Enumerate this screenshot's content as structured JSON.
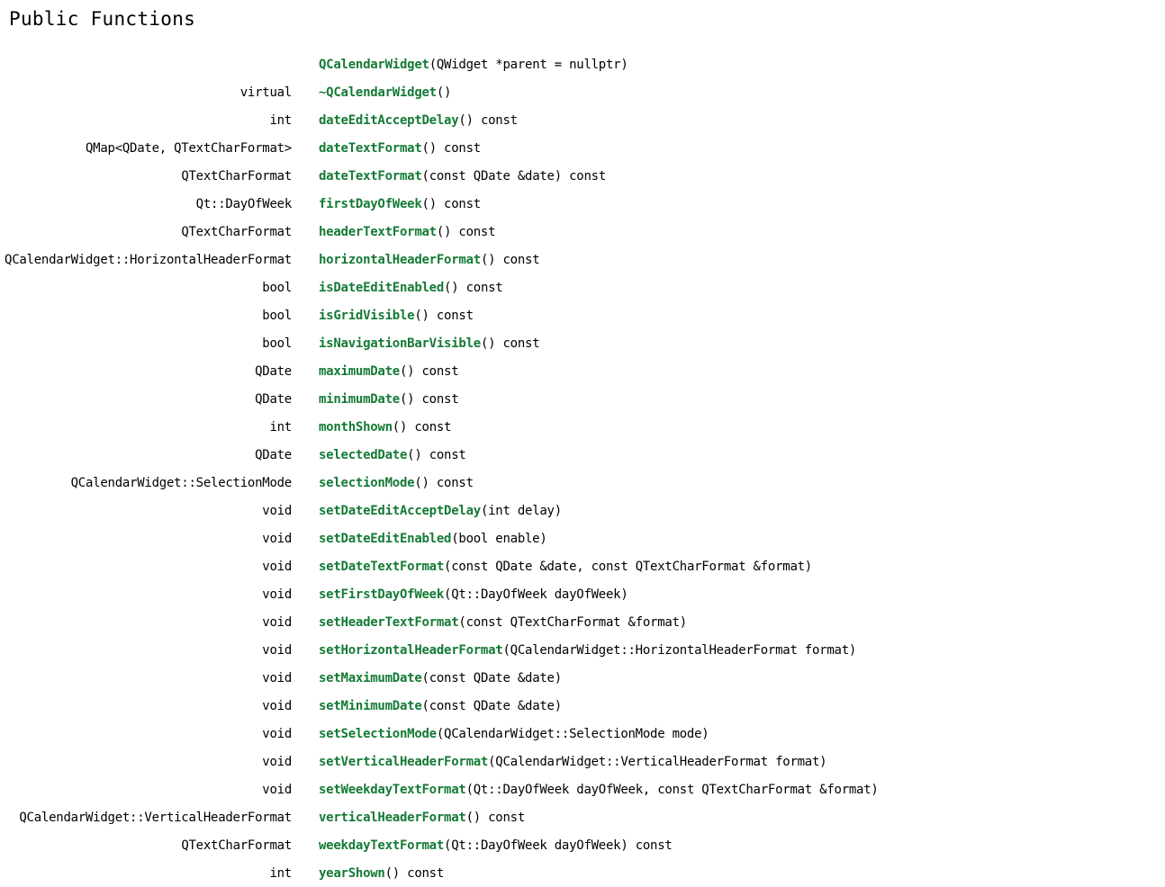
{
  "section_title": "Public Functions",
  "link_color": "#147a35",
  "functions": [
    {
      "ret": "",
      "name": "QCalendarWidget",
      "params": "(QWidget *parent = nullptr)",
      "suffix": ""
    },
    {
      "ret": "virtual",
      "name": "~QCalendarWidget",
      "params": "()",
      "suffix": ""
    },
    {
      "ret": "int",
      "name": "dateEditAcceptDelay",
      "params": "()",
      "suffix": " const"
    },
    {
      "ret": "QMap<QDate, QTextCharFormat>",
      "name": "dateTextFormat",
      "params": "()",
      "suffix": " const"
    },
    {
      "ret": "QTextCharFormat",
      "name": "dateTextFormat",
      "params": "(const QDate &date)",
      "suffix": " const"
    },
    {
      "ret": "Qt::DayOfWeek",
      "name": "firstDayOfWeek",
      "params": "()",
      "suffix": " const"
    },
    {
      "ret": "QTextCharFormat",
      "name": "headerTextFormat",
      "params": "()",
      "suffix": " const"
    },
    {
      "ret": "QCalendarWidget::HorizontalHeaderFormat",
      "name": "horizontalHeaderFormat",
      "params": "()",
      "suffix": " const"
    },
    {
      "ret": "bool",
      "name": "isDateEditEnabled",
      "params": "()",
      "suffix": " const"
    },
    {
      "ret": "bool",
      "name": "isGridVisible",
      "params": "()",
      "suffix": " const"
    },
    {
      "ret": "bool",
      "name": "isNavigationBarVisible",
      "params": "()",
      "suffix": " const"
    },
    {
      "ret": "QDate",
      "name": "maximumDate",
      "params": "()",
      "suffix": " const"
    },
    {
      "ret": "QDate",
      "name": "minimumDate",
      "params": "()",
      "suffix": " const"
    },
    {
      "ret": "int",
      "name": "monthShown",
      "params": "()",
      "suffix": " const"
    },
    {
      "ret": "QDate",
      "name": "selectedDate",
      "params": "()",
      "suffix": " const"
    },
    {
      "ret": "QCalendarWidget::SelectionMode",
      "name": "selectionMode",
      "params": "()",
      "suffix": " const"
    },
    {
      "ret": "void",
      "name": "setDateEditAcceptDelay",
      "params": "(int delay)",
      "suffix": ""
    },
    {
      "ret": "void",
      "name": "setDateEditEnabled",
      "params": "(bool enable)",
      "suffix": ""
    },
    {
      "ret": "void",
      "name": "setDateTextFormat",
      "params": "(const QDate &date, const QTextCharFormat &format)",
      "suffix": ""
    },
    {
      "ret": "void",
      "name": "setFirstDayOfWeek",
      "params": "(Qt::DayOfWeek dayOfWeek)",
      "suffix": ""
    },
    {
      "ret": "void",
      "name": "setHeaderTextFormat",
      "params": "(const QTextCharFormat &format)",
      "suffix": ""
    },
    {
      "ret": "void",
      "name": "setHorizontalHeaderFormat",
      "params": "(QCalendarWidget::HorizontalHeaderFormat format)",
      "suffix": ""
    },
    {
      "ret": "void",
      "name": "setMaximumDate",
      "params": "(const QDate &date)",
      "suffix": ""
    },
    {
      "ret": "void",
      "name": "setMinimumDate",
      "params": "(const QDate &date)",
      "suffix": ""
    },
    {
      "ret": "void",
      "name": "setSelectionMode",
      "params": "(QCalendarWidget::SelectionMode mode)",
      "suffix": ""
    },
    {
      "ret": "void",
      "name": "setVerticalHeaderFormat",
      "params": "(QCalendarWidget::VerticalHeaderFormat format)",
      "suffix": ""
    },
    {
      "ret": "void",
      "name": "setWeekdayTextFormat",
      "params": "(Qt::DayOfWeek dayOfWeek, const QTextCharFormat &format)",
      "suffix": ""
    },
    {
      "ret": "QCalendarWidget::VerticalHeaderFormat",
      "name": "verticalHeaderFormat",
      "params": "()",
      "suffix": " const"
    },
    {
      "ret": "QTextCharFormat",
      "name": "weekdayTextFormat",
      "params": "(Qt::DayOfWeek dayOfWeek)",
      "suffix": " const"
    },
    {
      "ret": "int",
      "name": "yearShown",
      "params": "()",
      "suffix": " const"
    }
  ]
}
